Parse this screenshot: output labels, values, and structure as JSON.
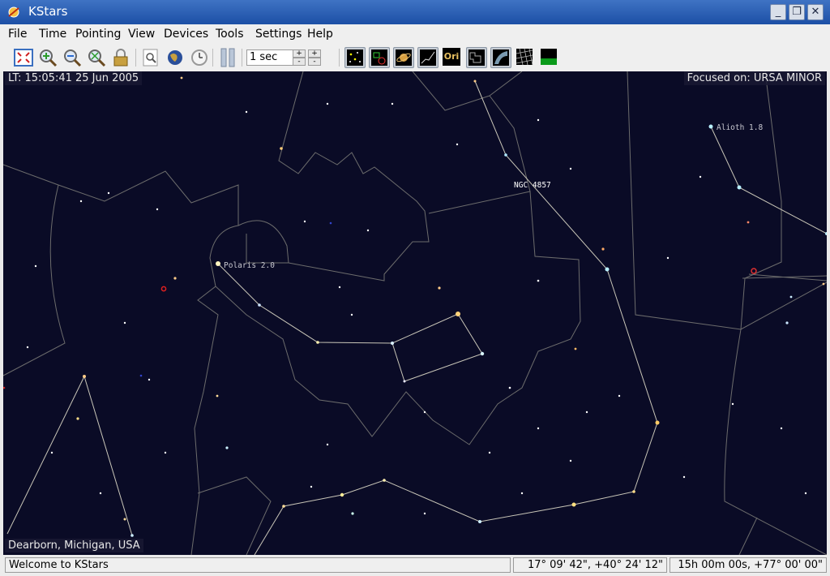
{
  "window": {
    "title": "KStars"
  },
  "window_controls": {
    "minimize": "_",
    "maximize": "❐",
    "close": "✕"
  },
  "menu": [
    "File",
    "Time",
    "Pointing",
    "View",
    "Devices",
    "Tools",
    "Settings",
    "Help"
  ],
  "toolbar": {
    "timestep_value": "1 sec",
    "spin_up": "+",
    "spin_down": "-",
    "ori_label": "Ori"
  },
  "sky": {
    "local_time": "LT: 15:05:41   25 Jun 2005",
    "focus": "Focused on: URSA MINOR",
    "location": "Dearborn, Michigan,  USA",
    "labels": {
      "polaris": "Polaris 2.0",
      "ngc": "NGC 4857",
      "alioth": "Alioth 1.8"
    }
  },
  "status": {
    "message": "Welcome to KStars",
    "altaz": "17° 09' 42\",  +40° 24' 12\"",
    "radec": "15h 00m 00s,  +77° 00' 00\""
  }
}
